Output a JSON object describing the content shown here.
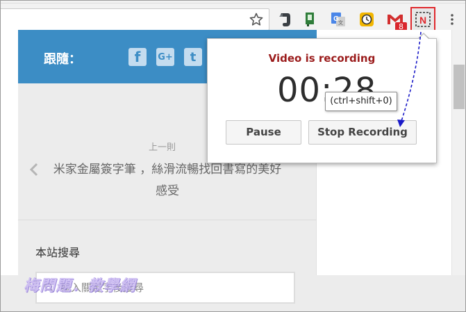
{
  "browser": {
    "extensions": [
      {
        "name": "evernote-icon"
      },
      {
        "name": "green-bookmark-extension-icon"
      },
      {
        "name": "google-translate-icon"
      },
      {
        "name": "clock-extension-icon"
      },
      {
        "name": "gmail-checker-icon"
      },
      {
        "name": "nimbus-capture-icon"
      }
    ],
    "gmail_badge": "8",
    "colors": {
      "nimbus_highlight": "#e0282d",
      "annotation_arrow": "#1a1ac8"
    }
  },
  "page": {
    "follow_label": "跟隨：",
    "social": {
      "facebook": "f",
      "googleplus": "G+",
      "twitter": "t"
    },
    "prev_label": "上一則",
    "prev_title": "米家金屬簽字筆 ，絲滑流暢找回書寫的美好感受",
    "search_title": "本站搜尋",
    "search_placeholder": "輸入關鍵字後搜尋",
    "watermark": "梅問題．教學網"
  },
  "popup": {
    "status": "Video is recording",
    "timer": "00:28",
    "pause_label": "Pause",
    "stop_label": "Stop Recording",
    "tooltip": "(ctrl+shift+0)",
    "status_color": "#9b1c1c"
  }
}
